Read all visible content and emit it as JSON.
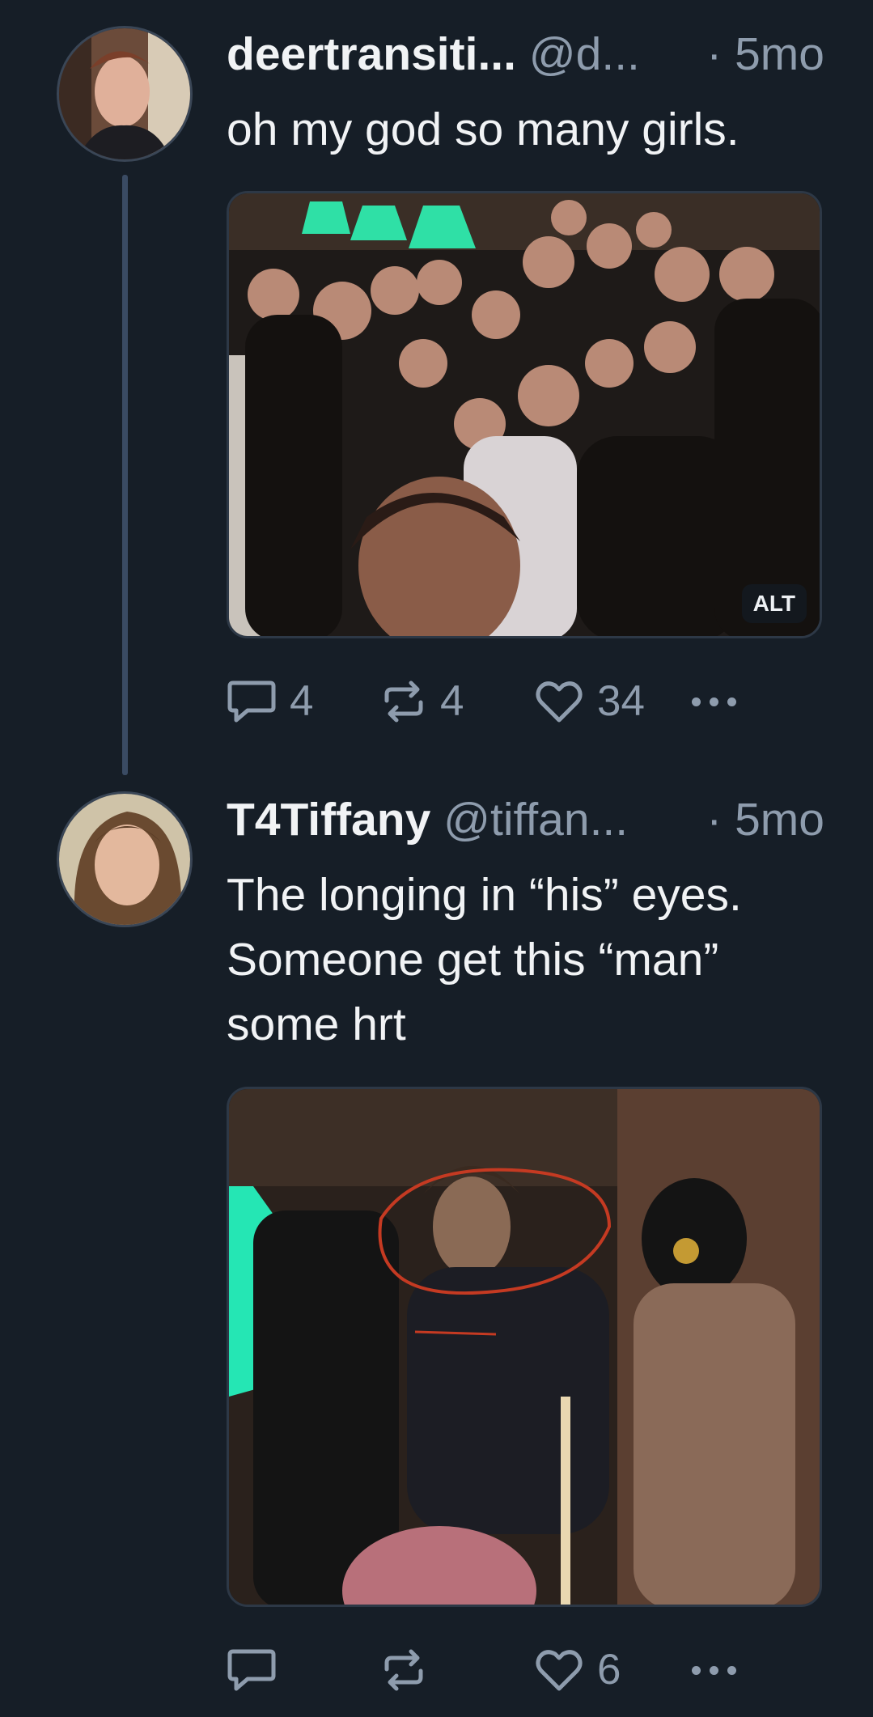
{
  "posts": [
    {
      "author": "deertransiti...",
      "handle": "@d...",
      "separator": "·",
      "time": "5mo",
      "text": "oh my god so many girls.",
      "media": {
        "alt_badge": "ALT",
        "icon": "photo-group-selfie"
      },
      "replies": "4",
      "reposts": "4",
      "likes": "34"
    },
    {
      "author": "T4Tiffany",
      "handle": "@tiffan...",
      "separator": "·",
      "time": "5mo",
      "text": "The longing in “his” eyes. Someone get this “man” some hrt",
      "media": {
        "icon": "photo-circled-man"
      },
      "replies": "",
      "reposts": "",
      "likes": "6"
    }
  ],
  "colors": {
    "background": "#161e27",
    "text": "#f1f3f5",
    "muted": "#8e9cad",
    "thread_line": "#3a4b63"
  }
}
